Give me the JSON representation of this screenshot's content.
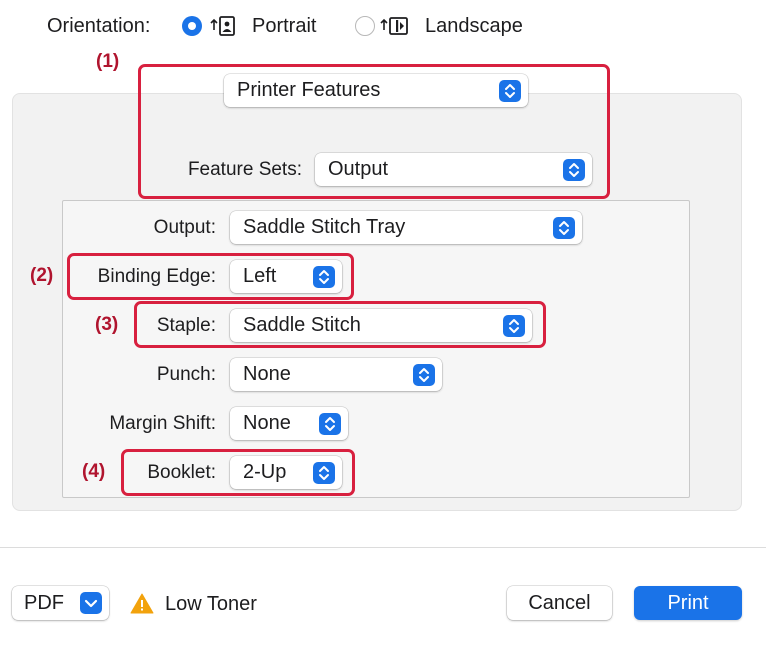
{
  "orientation": {
    "label": "Orientation:",
    "options": [
      {
        "label": "Portrait",
        "selected": true
      },
      {
        "label": "Landscape",
        "selected": false
      }
    ]
  },
  "panel_selector": {
    "value": "Printer Features"
  },
  "feature_sets": {
    "label": "Feature Sets:",
    "value": "Output"
  },
  "fields": {
    "output": {
      "label": "Output:",
      "value": "Saddle Stitch Tray"
    },
    "binding_edge": {
      "label": "Binding Edge:",
      "value": "Left"
    },
    "staple": {
      "label": "Staple:",
      "value": "Saddle Stitch"
    },
    "punch": {
      "label": "Punch:",
      "value": "None"
    },
    "margin_shift": {
      "label": "Margin Shift:",
      "value": "None"
    },
    "booklet": {
      "label": "Booklet:",
      "value": "2-Up"
    }
  },
  "callouts": [
    "(1)",
    "(2)",
    "(3)",
    "(4)"
  ],
  "footer": {
    "pdf_label": "PDF",
    "status_text": "Low Toner",
    "cancel_label": "Cancel",
    "print_label": "Print"
  },
  "colors": {
    "accent": "#1a73e8",
    "highlight": "#d8203f",
    "warning": "#f2a20c"
  },
  "icons": [
    "portrait-orientation-icon",
    "landscape-orientation-icon",
    "chevron-updown-icon",
    "chevron-down-icon",
    "warning-icon"
  ]
}
